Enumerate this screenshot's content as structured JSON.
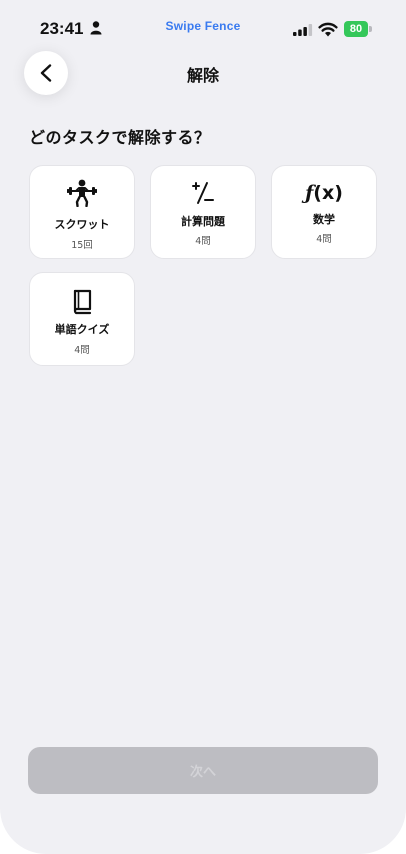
{
  "status_bar": {
    "time": "23:41",
    "app_name": "Swipe Fence",
    "battery": "80"
  },
  "header": {
    "title": "解除"
  },
  "main": {
    "prompt": "どのタスクで解除する？",
    "tasks": [
      {
        "icon": "weightlifting-icon",
        "label": "スクワット",
        "count": "15回"
      },
      {
        "icon": "plus-minus-icon",
        "label": "計算問題",
        "count": "4問"
      },
      {
        "icon": "function-icon",
        "label": "数学",
        "count": "4問",
        "glyph": "ƒ",
        "glyph_args": "(x)"
      },
      {
        "icon": "book-icon",
        "label": "単語クイズ",
        "count": "4問"
      }
    ]
  },
  "footer": {
    "next_label": "次へ"
  },
  "colors": {
    "background": "#f0f0f4",
    "app_name": "#3a7bf0",
    "battery": "#34c759",
    "next_button_disabled": "#bdbdc2"
  }
}
